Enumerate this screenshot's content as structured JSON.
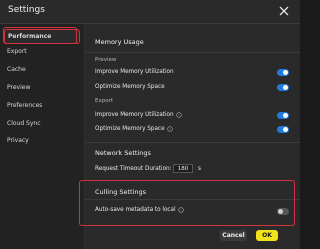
{
  "header": {
    "title": "Settings",
    "close_icon": "close-icon"
  },
  "sidebar": {
    "items": [
      {
        "label": "Performance"
      },
      {
        "label": "Export"
      },
      {
        "label": "Cache"
      },
      {
        "label": "Preview"
      },
      {
        "label": "Preferences"
      },
      {
        "label": "Cloud Sync"
      },
      {
        "label": "Privacy"
      }
    ]
  },
  "content": {
    "memory": {
      "title": "Memory Usage",
      "preview_label": "Preview",
      "preview_rows": [
        {
          "label": "Improve Memory Utilization",
          "on": true
        },
        {
          "label": "Optimize Memory Space",
          "on": true
        }
      ],
      "export_label": "Export",
      "export_rows": [
        {
          "label": "Improve Memory Utilization",
          "on": true,
          "info_icon": "info-icon"
        },
        {
          "label": "Optimize Memory Space",
          "on": true,
          "info_icon": "info-icon"
        }
      ]
    },
    "network": {
      "title": "Network Settings",
      "timeout_label": "Request Timeout Duration:",
      "timeout_value": "180",
      "timeout_unit": "s"
    },
    "culling": {
      "title": "Culling Settings",
      "row": {
        "label": "Auto-save metadata to local",
        "on": false,
        "info_icon": "info-icon"
      }
    }
  },
  "footer": {
    "cancel_label": "Cancel",
    "ok_label": "OK"
  },
  "colors": {
    "accent": "#1f7ae0",
    "highlight": "#d2323c",
    "ok": "#f2e21a"
  }
}
